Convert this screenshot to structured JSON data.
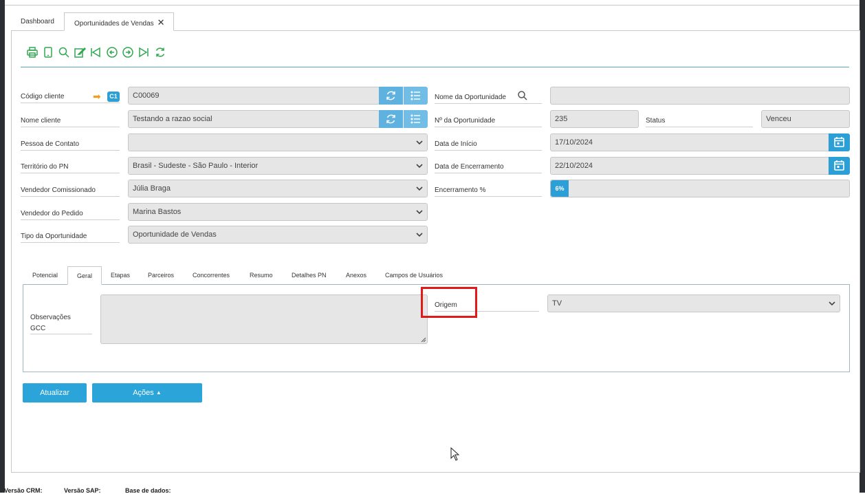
{
  "tabs": {
    "dashboard": "Dashboard",
    "oportunidades": "Oportunidades de Vendas",
    "close": "✕"
  },
  "toolbar": {
    "icons": [
      "printer-icon",
      "tablet-icon",
      "search-icon",
      "edit-icon",
      "first-icon",
      "previous-icon",
      "next-icon",
      "last-icon",
      "refresh-icon"
    ],
    "color": "#2fa84f"
  },
  "form": {
    "codigo_cliente": {
      "label": "Código cliente",
      "badge": "C1",
      "value": "C00069"
    },
    "nome_cliente": {
      "label": "Nome cliente",
      "value": "Testando a razao social"
    },
    "pessoa_contato": {
      "label": "Pessoa de Contato",
      "value": ""
    },
    "territorio": {
      "label": "Território do PN",
      "value": "Brasil - Sudeste - São Paulo - Interior"
    },
    "vendedor_comissionado": {
      "label": "Vendedor Comissionado",
      "value": "Júlia Braga"
    },
    "vendedor_pedido": {
      "label": "Vendedor do Pedido",
      "value": "Marina Bastos"
    },
    "tipo_oportunidade": {
      "label": "Tipo da Oportunidade",
      "value": "Oportunidade de Vendas"
    },
    "nome_oportunidade": {
      "label": "Nome da Oportunidade",
      "value": ""
    },
    "num_oportunidade": {
      "label": "Nº da Oportunidade",
      "value": "235"
    },
    "status": {
      "label": "Status",
      "value": "Venceu"
    },
    "data_inicio": {
      "label": "Data de Início",
      "value": "17/10/2024"
    },
    "data_encerramento": {
      "label": "Data de Encerramento",
      "value": "22/10/2024"
    },
    "encerramento_pct": {
      "label": "Encerramento %",
      "value": "6%",
      "fraction": 0.06
    }
  },
  "subtabs": [
    "Potencial",
    "Geral",
    "Etapas",
    "Parceiros",
    "Concorrentes",
    "Resumo",
    "Detalhes PN",
    "Anexos",
    "Campos de Usuários"
  ],
  "geral": {
    "observacoes_label_1": "Observações",
    "observacoes_label_2": "GCC",
    "observacoes_value": "",
    "origem_label": "Origem",
    "origem_value": "TV"
  },
  "actions": {
    "atualizar": "Atualizar",
    "acoes": "Ações"
  },
  "footer": {
    "versao_crm": "Versão CRM:",
    "versao_sap": "Versão SAP:",
    "base_dados": "Base de dados:"
  },
  "colors": {
    "accent": "#2ba4d9",
    "highlight": "#e01919",
    "field_bg": "#e6e6e6"
  }
}
